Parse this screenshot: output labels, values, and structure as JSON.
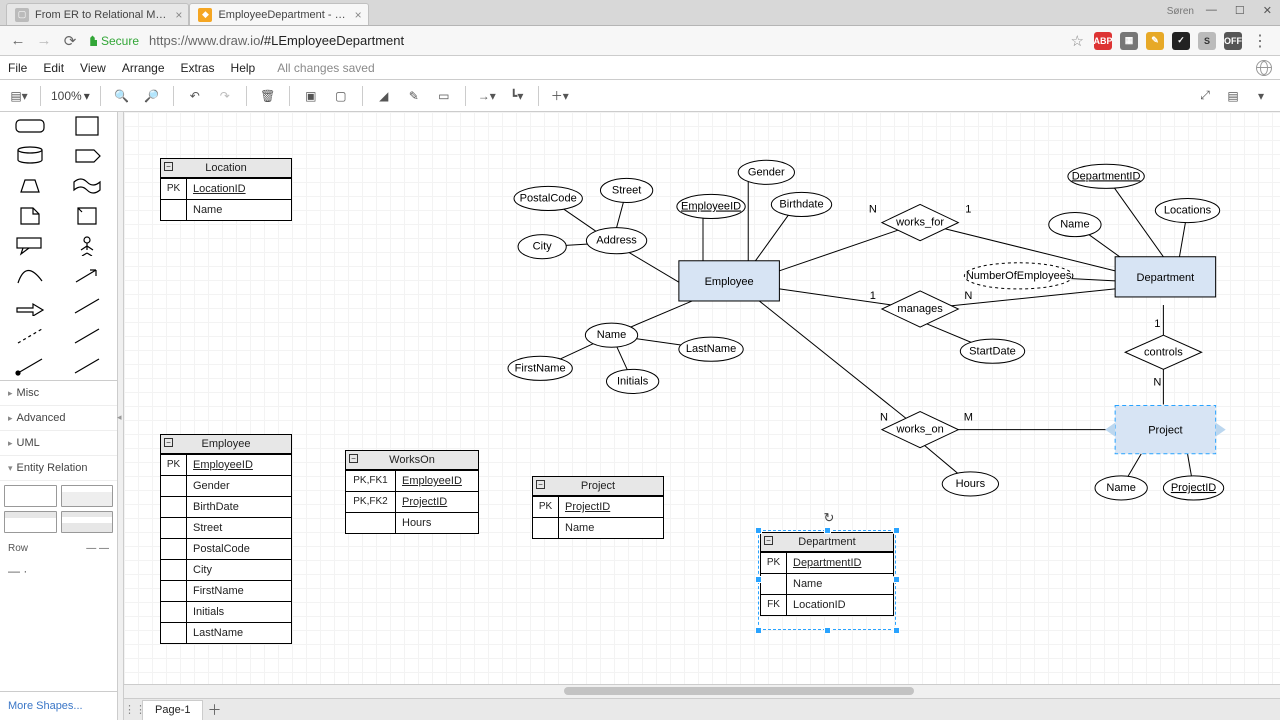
{
  "browser": {
    "tabs": [
      {
        "title": "From ER to Relational M…",
        "active": false
      },
      {
        "title": "EmployeeDepartment - …",
        "active": true
      }
    ],
    "user": "Søren",
    "secure_label": "Secure",
    "url_host": "https://www.draw.io",
    "url_path": "/#LEmployeeDepartment",
    "star": "☆"
  },
  "menus": [
    "File",
    "Edit",
    "View",
    "Arrange",
    "Extras",
    "Help"
  ],
  "save_state": "All changes saved",
  "zoom": "100%",
  "side_sections": {
    "misc": "Misc",
    "advanced": "Advanced",
    "uml": "UML",
    "er": "Entity Relation",
    "row": "Row"
  },
  "more_shapes": "More Shapes...",
  "footer": {
    "page": "Page-1"
  },
  "tables": {
    "location": {
      "title": "Location",
      "rows": [
        {
          "k": "PK",
          "v": "LocationID",
          "u": true
        },
        {
          "k": "",
          "v": "Name"
        }
      ]
    },
    "employee": {
      "title": "Employee",
      "rows": [
        {
          "k": "PK",
          "v": "EmployeeID",
          "u": true
        },
        {
          "k": "",
          "v": "Gender"
        },
        {
          "k": "",
          "v": "BirthDate"
        },
        {
          "k": "",
          "v": "Street"
        },
        {
          "k": "",
          "v": "PostalCode"
        },
        {
          "k": "",
          "v": "City"
        },
        {
          "k": "",
          "v": "FirstName"
        },
        {
          "k": "",
          "v": "Initials"
        },
        {
          "k": "",
          "v": "LastName"
        }
      ]
    },
    "workson": {
      "title": "WorksOn",
      "rows": [
        {
          "k": "PK,FK1",
          "v": "EmployeeID",
          "u": true
        },
        {
          "k": "PK,FK2",
          "v": "ProjectID",
          "u": true
        },
        {
          "k": "",
          "v": "Hours"
        }
      ]
    },
    "project": {
      "title": "Project",
      "rows": [
        {
          "k": "PK",
          "v": "ProjectID",
          "u": true
        },
        {
          "k": "",
          "v": "Name"
        }
      ]
    },
    "department": {
      "title": "Department",
      "rows": [
        {
          "k": "PK",
          "v": "DepartmentID",
          "u": true
        },
        {
          "k": "",
          "v": "Name"
        },
        {
          "k": "FK",
          "v": "LocationID"
        }
      ]
    }
  },
  "er": {
    "entities": {
      "employee": "Employee",
      "department": "Department",
      "project": "Project"
    },
    "rels": {
      "works_for": "works_for",
      "manages": "manages",
      "controls": "controls",
      "works_on": "works_on"
    },
    "card": {
      "works_for_emp": "N",
      "works_for_dep": "1",
      "manages_emp": "1",
      "manages_dep": "N",
      "controls_dep": "1",
      "controls_prj": "N",
      "works_on_emp": "N",
      "works_on_prj": "M"
    },
    "attrs": {
      "gender": "Gender",
      "birthdate": "Birthdate",
      "employeeid": "EmployeeID",
      "address": "Address",
      "street": "Street",
      "postalcode": "PostalCode",
      "city": "City",
      "name_emp": "Name",
      "firstname": "FirstName",
      "lastname": "LastName",
      "initials": "Initials",
      "numberofemployees": "NumberOfEmployees",
      "startdate": "StartDate",
      "hours": "Hours",
      "dep_name": "Name",
      "departmentid": "DepartmentID",
      "locations": "Locations",
      "prj_name": "Name",
      "projectid": "ProjectID"
    }
  }
}
